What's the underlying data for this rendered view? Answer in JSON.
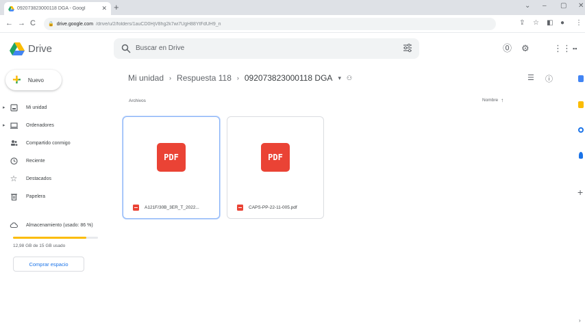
{
  "browser": {
    "tab_title": "092073823000118 DGA - Googl",
    "tab_close": "✕",
    "new_tab": "+",
    "window_controls": [
      "⌄",
      "–",
      "▢",
      "✕"
    ],
    "url_host": "drive.google.com",
    "url_path": "/drive/u/2/folders/1auCD0HjV8hg2k7wi7UgH88YtFdUH9_n"
  },
  "drive": {
    "logo_text": "Drive",
    "search_placeholder": "Buscar en Drive"
  },
  "sidebar": {
    "new_label": "Nuevo",
    "items": [
      {
        "label": "Mi unidad",
        "caret": "▸"
      },
      {
        "label": "Ordenadores",
        "caret": "▸"
      },
      {
        "label": "Compartido conmigo",
        "caret": ""
      },
      {
        "label": "Reciente",
        "caret": ""
      },
      {
        "label": "Destacados",
        "caret": ""
      },
      {
        "label": "Papelera",
        "caret": ""
      }
    ],
    "storage_label": "Almacenamiento (usado: 86 %)",
    "storage_percent": 86,
    "storage_usage": "12,98 GB de 15 GB usado",
    "buy_label": "Comprar espacio"
  },
  "main": {
    "breadcrumb": [
      "Mi unidad",
      "Respuesta 118",
      "092073823000118 DGA"
    ],
    "breadcrumb_sep": "›",
    "section_label": "Archivos",
    "sort_label": "Nombre",
    "sort_arrow": "↑",
    "files": [
      {
        "name": "A121F/30B_3ER_T_2022...",
        "thumb": "PDF",
        "selected": true
      },
      {
        "name": "CAPS-PP-22-11-005.pdf",
        "thumb": "PDF",
        "selected": false
      }
    ]
  },
  "colors": {
    "pdf_red": "#ea4335",
    "accent_blue": "#1a73e8",
    "storage_yellow": "#fbbc04"
  }
}
